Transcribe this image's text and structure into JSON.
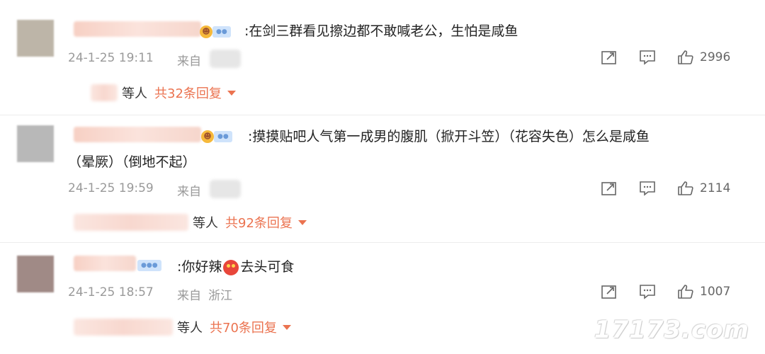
{
  "comments": [
    {
      "text_line1": ":在剑三群看见擦边都不敢喊老公，生怕是咸鱼",
      "text_line2": "",
      "time": "24-1-25 19:11",
      "from_label": "来自",
      "region": "",
      "share_icon": "share-icon",
      "comment_icon": "comment-icon",
      "like_icon": "thumbs-up-icon",
      "like_count": "2996",
      "reply_prefix": "等人",
      "reply_link": "共32条回复"
    },
    {
      "text_line1": ":摸摸贴吧人气第一成男的腹肌（掀开斗笠）（花容失色）怎么是咸鱼",
      "text_line2": "（晕厥）（倒地不起）",
      "time": "24-1-25 19:59",
      "from_label": "来自",
      "region": "",
      "share_icon": "share-icon",
      "comment_icon": "comment-icon",
      "like_icon": "thumbs-up-icon",
      "like_count": "2114",
      "reply_prefix": "等人",
      "reply_link": "共92条回复"
    },
    {
      "text_before_emoji": ":你好辣",
      "text_after_emoji": "去头可食",
      "time": "24-1-25 18:57",
      "from_label": "来自",
      "region": "浙江",
      "share_icon": "share-icon",
      "comment_icon": "comment-icon",
      "like_icon": "thumbs-up-icon",
      "like_count": "1007",
      "reply_prefix": "等人",
      "reply_link": "共70条回复"
    }
  ],
  "watermark": "17173.com",
  "colors": {
    "accent": "#eb7350",
    "meta": "#9a9a9a",
    "text": "#222222"
  }
}
